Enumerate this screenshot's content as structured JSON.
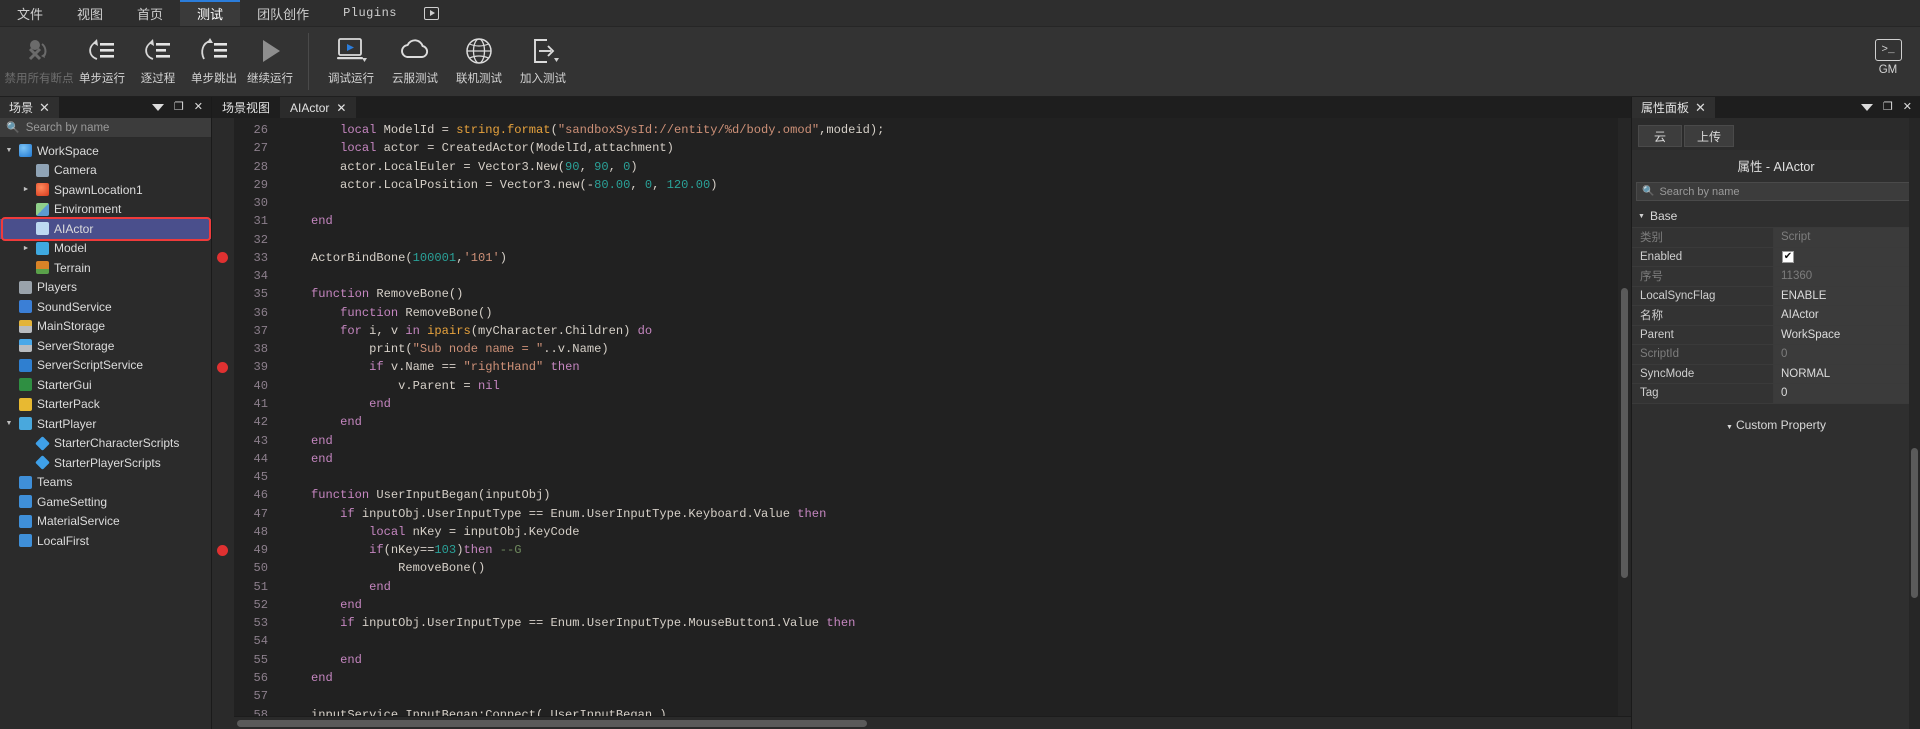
{
  "menubar": {
    "items": [
      {
        "label": "文件",
        "active": false
      },
      {
        "label": "视图",
        "active": false
      },
      {
        "label": "首页",
        "active": false
      },
      {
        "label": "测试",
        "active": true
      },
      {
        "label": "团队创作",
        "active": false
      },
      {
        "label": "Plugins",
        "active": false
      }
    ],
    "play_button": "play-in-box-icon"
  },
  "ribbon": {
    "group1": [
      {
        "label": "禁用所有断点",
        "icon": "disable-breakpoints-icon",
        "disabled": true
      },
      {
        "label": "单步运行",
        "icon": "step-into-icon",
        "disabled": false
      },
      {
        "label": "逐过程",
        "icon": "step-over-icon",
        "disabled": false
      },
      {
        "label": "单步跳出",
        "icon": "step-out-icon",
        "disabled": false
      },
      {
        "label": "继续运行",
        "icon": "continue-play-icon",
        "disabled": false
      }
    ],
    "group2": [
      {
        "label": "调试运行",
        "icon": "monitor-play-icon",
        "disabled": false
      },
      {
        "label": "云服测试",
        "icon": "cloud-icon",
        "disabled": false
      },
      {
        "label": "联机测试",
        "icon": "globe-icon",
        "disabled": false
      },
      {
        "label": "加入测试",
        "icon": "enter-arrow-icon",
        "disabled": false
      }
    ],
    "gm": {
      "label": "GM",
      "icon": "console-icon",
      "glyph": ">_"
    }
  },
  "scene_panel": {
    "tab_label": "场景",
    "close_icon": "close-icon",
    "menu_icon": "chevron-down-icon",
    "float_icon": "restore-icon",
    "panel_close_icon": "close-icon",
    "search": {
      "placeholder": "Search by name",
      "value": "",
      "icon": "search-icon"
    },
    "tree": [
      {
        "label": "WorkSpace",
        "depth": 0,
        "arrow": "open",
        "icon": "workspace-icon",
        "selected": false
      },
      {
        "label": "Camera",
        "depth": 1,
        "arrow": "none",
        "icon": "camera-icon",
        "selected": false
      },
      {
        "label": "SpawnLocation1",
        "depth": 1,
        "arrow": "closed",
        "icon": "spawn-location-icon",
        "selected": false
      },
      {
        "label": "Environment",
        "depth": 1,
        "arrow": "none",
        "icon": "environment-icon",
        "selected": false
      },
      {
        "label": "AIActor",
        "depth": 1,
        "arrow": "none",
        "icon": "lua-script-icon",
        "selected": true,
        "highlighted": true
      },
      {
        "label": "Model",
        "depth": 1,
        "arrow": "closed",
        "icon": "model-icon",
        "selected": false
      },
      {
        "label": "Terrain",
        "depth": 1,
        "arrow": "none",
        "icon": "terrain-icon",
        "selected": false
      },
      {
        "label": "Players",
        "depth": 0,
        "arrow": "none",
        "icon": "players-icon",
        "selected": false
      },
      {
        "label": "SoundService",
        "depth": 0,
        "arrow": "none",
        "icon": "sound-service-icon",
        "selected": false
      },
      {
        "label": "MainStorage",
        "depth": 0,
        "arrow": "none",
        "icon": "main-storage-icon",
        "selected": false
      },
      {
        "label": "ServerStorage",
        "depth": 0,
        "arrow": "none",
        "icon": "server-storage-icon",
        "selected": false
      },
      {
        "label": "ServerScriptService",
        "depth": 0,
        "arrow": "none",
        "icon": "server-script-service-icon",
        "selected": false
      },
      {
        "label": "StarterGui",
        "depth": 0,
        "arrow": "none",
        "icon": "starter-gui-icon",
        "selected": false
      },
      {
        "label": "StarterPack",
        "depth": 0,
        "arrow": "none",
        "icon": "starter-pack-icon",
        "selected": false
      },
      {
        "label": "StartPlayer",
        "depth": 0,
        "arrow": "open",
        "icon": "start-player-icon",
        "selected": false
      },
      {
        "label": "StarterCharacterScripts",
        "depth": 1,
        "arrow": "none",
        "icon": "starter-character-scripts-icon",
        "selected": false
      },
      {
        "label": "StarterPlayerScripts",
        "depth": 1,
        "arrow": "none",
        "icon": "starter-player-scripts-icon",
        "selected": false
      },
      {
        "label": "Teams",
        "depth": 0,
        "arrow": "none",
        "icon": "teams-icon",
        "selected": false
      },
      {
        "label": "GameSetting",
        "depth": 0,
        "arrow": "none",
        "icon": "game-setting-icon",
        "selected": false
      },
      {
        "label": "MaterialService",
        "depth": 0,
        "arrow": "none",
        "icon": "material-service-icon",
        "selected": false
      },
      {
        "label": "LocalFirst",
        "depth": 0,
        "arrow": "none",
        "icon": "local-first-icon",
        "selected": false
      }
    ]
  },
  "editor": {
    "tabs": [
      {
        "label": "场景视图",
        "active": false,
        "closable": false
      },
      {
        "label": "AIActor",
        "active": true,
        "closable": true,
        "close_icon": "close-icon"
      }
    ],
    "first_line_number": 26,
    "breakpoint_lines": [
      33,
      39,
      49
    ],
    "lines": [
      {
        "n": 26,
        "tokens": [
          {
            "t": "        ",
            "c": "plain"
          },
          {
            "t": "local",
            "c": "local"
          },
          {
            "t": " ModelId = ",
            "c": "plain"
          },
          {
            "t": "string.format",
            "c": "global"
          },
          {
            "t": "(",
            "c": "plain"
          },
          {
            "t": "\"sandboxSysId://entity/%d/body.omod\"",
            "c": "str"
          },
          {
            "t": ",modeid);",
            "c": "plain"
          }
        ]
      },
      {
        "n": 27,
        "tokens": [
          {
            "t": "        ",
            "c": "plain"
          },
          {
            "t": "local",
            "c": "local"
          },
          {
            "t": " actor = CreatedActor(ModelId,attachment)",
            "c": "plain"
          }
        ]
      },
      {
        "n": 28,
        "tokens": [
          {
            "t": "        actor.LocalEuler = Vector3.New(",
            "c": "plain"
          },
          {
            "t": "90",
            "c": "num"
          },
          {
            "t": ", ",
            "c": "plain"
          },
          {
            "t": "90",
            "c": "num"
          },
          {
            "t": ", ",
            "c": "plain"
          },
          {
            "t": "0",
            "c": "num"
          },
          {
            "t": ")",
            "c": "plain"
          }
        ]
      },
      {
        "n": 29,
        "tokens": [
          {
            "t": "        actor.LocalPosition = Vector3.new(-",
            "c": "plain"
          },
          {
            "t": "80.00",
            "c": "num"
          },
          {
            "t": ", ",
            "c": "plain"
          },
          {
            "t": "0",
            "c": "num"
          },
          {
            "t": ", ",
            "c": "plain"
          },
          {
            "t": "120.00",
            "c": "num"
          },
          {
            "t": ")",
            "c": "plain"
          }
        ]
      },
      {
        "n": 30,
        "tokens": []
      },
      {
        "n": 31,
        "tokens": [
          {
            "t": "    ",
            "c": "plain"
          },
          {
            "t": "end",
            "c": "kw"
          }
        ]
      },
      {
        "n": 32,
        "tokens": []
      },
      {
        "n": 33,
        "tokens": [
          {
            "t": "    ActorBindBone(",
            "c": "plain"
          },
          {
            "t": "100001",
            "c": "num"
          },
          {
            "t": ",",
            "c": "plain"
          },
          {
            "t": "'101'",
            "c": "str"
          },
          {
            "t": ")",
            "c": "plain"
          }
        ]
      },
      {
        "n": 34,
        "tokens": []
      },
      {
        "n": 35,
        "tokens": [
          {
            "t": "    ",
            "c": "plain"
          },
          {
            "t": "function",
            "c": "kw"
          },
          {
            "t": " RemoveBone()",
            "c": "plain"
          }
        ]
      },
      {
        "n": 36,
        "tokens": [
          {
            "t": "        ",
            "c": "plain"
          },
          {
            "t": "function",
            "c": "kw"
          },
          {
            "t": " RemoveBone()",
            "c": "plain"
          }
        ]
      },
      {
        "n": 37,
        "tokens": [
          {
            "t": "        ",
            "c": "plain"
          },
          {
            "t": "for",
            "c": "ctrl"
          },
          {
            "t": " i, v ",
            "c": "plain"
          },
          {
            "t": "in",
            "c": "ctrl"
          },
          {
            "t": " ",
            "c": "plain"
          },
          {
            "t": "ipairs",
            "c": "global"
          },
          {
            "t": "(myCharacter.Children) ",
            "c": "plain"
          },
          {
            "t": "do",
            "c": "ctrl"
          }
        ]
      },
      {
        "n": 38,
        "tokens": [
          {
            "t": "            print(",
            "c": "plain"
          },
          {
            "t": "\"Sub node name = \"",
            "c": "str"
          },
          {
            "t": "..v.Name)",
            "c": "plain"
          }
        ]
      },
      {
        "n": 39,
        "tokens": [
          {
            "t": "            ",
            "c": "plain"
          },
          {
            "t": "if",
            "c": "ctrl"
          },
          {
            "t": " v.Name == ",
            "c": "plain"
          },
          {
            "t": "\"rightHand\"",
            "c": "str"
          },
          {
            "t": " ",
            "c": "plain"
          },
          {
            "t": "then",
            "c": "ctrl"
          }
        ]
      },
      {
        "n": 40,
        "tokens": [
          {
            "t": "                v.Parent = ",
            "c": "plain"
          },
          {
            "t": "nil",
            "c": "kw2"
          }
        ]
      },
      {
        "n": 41,
        "tokens": [
          {
            "t": "            ",
            "c": "plain"
          },
          {
            "t": "end",
            "c": "kw"
          }
        ]
      },
      {
        "n": 42,
        "tokens": [
          {
            "t": "        ",
            "c": "plain"
          },
          {
            "t": "end",
            "c": "kw"
          }
        ]
      },
      {
        "n": 43,
        "tokens": [
          {
            "t": "    ",
            "c": "plain"
          },
          {
            "t": "end",
            "c": "kw"
          }
        ]
      },
      {
        "n": 44,
        "tokens": [
          {
            "t": "    ",
            "c": "plain"
          },
          {
            "t": "end",
            "c": "kw"
          }
        ]
      },
      {
        "n": 45,
        "tokens": []
      },
      {
        "n": 46,
        "tokens": [
          {
            "t": "    ",
            "c": "plain"
          },
          {
            "t": "function",
            "c": "kw"
          },
          {
            "t": " UserInputBegan(inputObj)",
            "c": "plain"
          }
        ]
      },
      {
        "n": 47,
        "tokens": [
          {
            "t": "        ",
            "c": "plain"
          },
          {
            "t": "if",
            "c": "ctrl"
          },
          {
            "t": " inputObj.UserInputType == Enum.UserInputType.Keyboard.Value ",
            "c": "plain"
          },
          {
            "t": "then",
            "c": "ctrl"
          }
        ]
      },
      {
        "n": 48,
        "tokens": [
          {
            "t": "            ",
            "c": "plain"
          },
          {
            "t": "local",
            "c": "local"
          },
          {
            "t": " nKey = inputObj.KeyCode",
            "c": "plain"
          }
        ]
      },
      {
        "n": 49,
        "tokens": [
          {
            "t": "            ",
            "c": "plain"
          },
          {
            "t": "if",
            "c": "ctrl"
          },
          {
            "t": "(nKey==",
            "c": "plain"
          },
          {
            "t": "103",
            "c": "num"
          },
          {
            "t": ")",
            "c": "plain"
          },
          {
            "t": "then",
            "c": "ctrl"
          },
          {
            "t": " ",
            "c": "plain"
          },
          {
            "t": "--G",
            "c": "cmt"
          }
        ]
      },
      {
        "n": 50,
        "tokens": [
          {
            "t": "                RemoveBone()",
            "c": "plain"
          }
        ]
      },
      {
        "n": 51,
        "tokens": [
          {
            "t": "            ",
            "c": "plain"
          },
          {
            "t": "end",
            "c": "kw"
          }
        ]
      },
      {
        "n": 52,
        "tokens": [
          {
            "t": "        ",
            "c": "plain"
          },
          {
            "t": "end",
            "c": "kw"
          }
        ]
      },
      {
        "n": 53,
        "tokens": [
          {
            "t": "        ",
            "c": "plain"
          },
          {
            "t": "if",
            "c": "ctrl"
          },
          {
            "t": " inputObj.UserInputType == Enum.UserInputType.MouseButton1.Value ",
            "c": "plain"
          },
          {
            "t": "then",
            "c": "ctrl"
          }
        ]
      },
      {
        "n": 54,
        "tokens": []
      },
      {
        "n": 55,
        "tokens": [
          {
            "t": "        ",
            "c": "plain"
          },
          {
            "t": "end",
            "c": "kw"
          }
        ]
      },
      {
        "n": 56,
        "tokens": [
          {
            "t": "    ",
            "c": "plain"
          },
          {
            "t": "end",
            "c": "kw"
          }
        ]
      },
      {
        "n": 57,
        "tokens": []
      },
      {
        "n": 58,
        "tokens": [
          {
            "t": "    inputService.InputBegan:Connect( UserInputBegan )",
            "c": "plain"
          }
        ]
      }
    ]
  },
  "properties_panel": {
    "tab_label": "属性面板",
    "close_icon": "close-icon",
    "menu_icon": "chevron-down-icon",
    "float_icon": "restore-icon",
    "panel_close_icon": "close-icon",
    "buttons": [
      {
        "label": "云",
        "name": "cloud-button"
      },
      {
        "label": "上传",
        "name": "upload-button"
      }
    ],
    "title": "属性 - AIActor",
    "search": {
      "placeholder": "Search by name",
      "value": "",
      "icon": "search-icon"
    },
    "section_base": "Base",
    "rows": [
      {
        "name": "类别",
        "value": "Script",
        "dim": true,
        "type": "text"
      },
      {
        "name": "Enabled",
        "value": "",
        "dim": false,
        "type": "checkbox",
        "checked": true
      },
      {
        "name": "序号",
        "value": "11360",
        "dim": true,
        "type": "text"
      },
      {
        "name": "LocalSyncFlag",
        "value": "ENABLE",
        "dim": false,
        "type": "text"
      },
      {
        "name": "名称",
        "value": "AIActor",
        "dim": false,
        "type": "text"
      },
      {
        "name": "Parent",
        "value": "WorkSpace",
        "dim": false,
        "type": "text"
      },
      {
        "name": "ScriptId",
        "value": "0",
        "dim": true,
        "type": "text"
      },
      {
        "name": "SyncMode",
        "value": "NORMAL",
        "dim": false,
        "type": "text"
      },
      {
        "name": "Tag",
        "value": "0",
        "dim": false,
        "type": "text"
      }
    ],
    "custom_property": "Custom Property"
  },
  "colors": {
    "accent": "#2b7ddb",
    "selection": "#4a4f8c",
    "highlight_ring": "#ef3b3b",
    "breakpoint": "#e03131"
  }
}
